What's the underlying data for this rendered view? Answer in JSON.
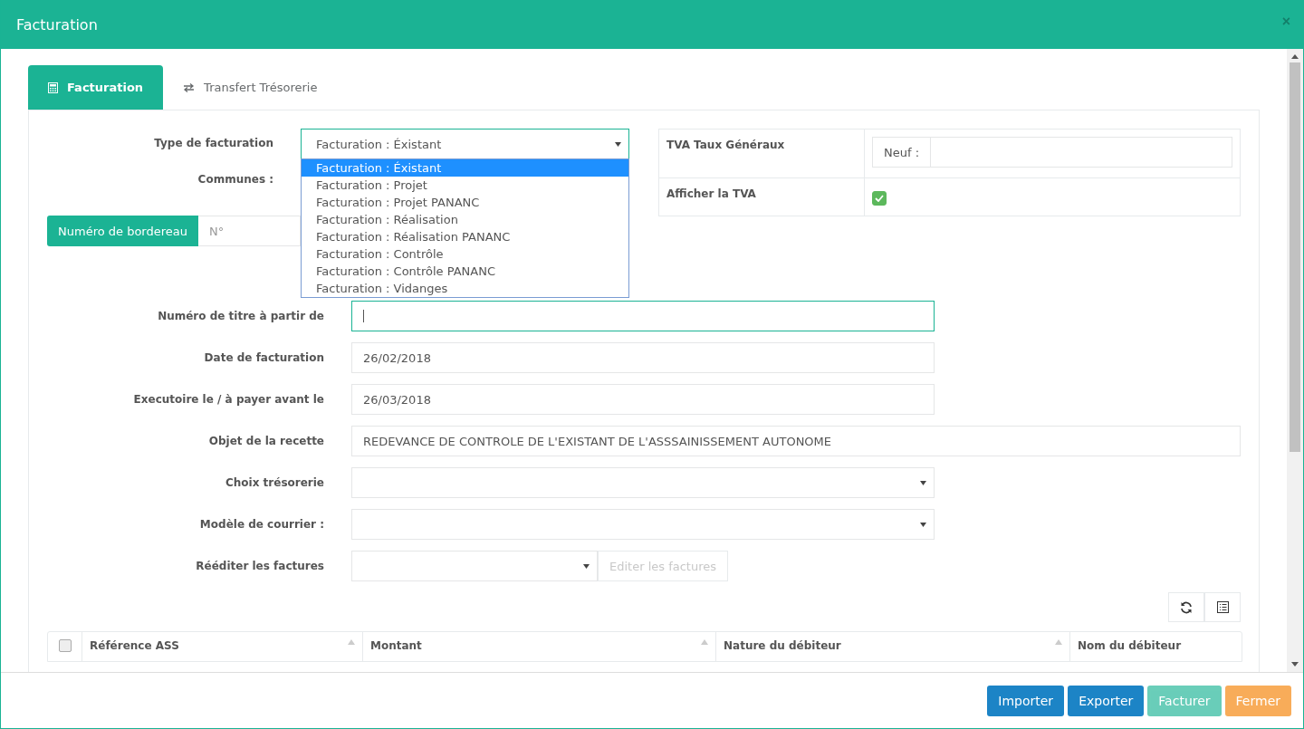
{
  "window": {
    "title": "Facturation",
    "close": "×"
  },
  "tabs": [
    {
      "label": "Facturation",
      "selected": true
    },
    {
      "label": "Transfert Trésorerie",
      "selected": false
    }
  ],
  "type_facturation": {
    "label": "Type de facturation",
    "value": "Facturation : Éxistant",
    "expanded": true,
    "options": [
      {
        "label": "Facturation : Éxistant",
        "selected": true
      },
      {
        "label": "Facturation : Projet",
        "selected": false
      },
      {
        "label": "Facturation : Projet PANANC",
        "selected": false
      },
      {
        "label": "Facturation : Réalisation",
        "selected": false
      },
      {
        "label": "Facturation : Réalisation PANANC",
        "selected": false
      },
      {
        "label": "Facturation : Contrôle",
        "selected": false
      },
      {
        "label": "Facturation : Contrôle PANANC",
        "selected": false
      },
      {
        "label": "Facturation : Vidanges",
        "selected": false
      }
    ]
  },
  "communes": {
    "label": "Communes :"
  },
  "tva": {
    "taux_label": "TVA Taux Généraux",
    "neuf_label": "Neuf :",
    "afficher_label": "Afficher la TVA",
    "afficher_checked": true
  },
  "bordereau": {
    "label": "Numéro de bordereau",
    "placeholder": "N°"
  },
  "fields": [
    {
      "kind": "text",
      "label": "Numéro de titre à partir de",
      "focused": true
    },
    {
      "kind": "text",
      "label": "Date de facturation",
      "value": "26/02/2018",
      "focused": false
    },
    {
      "kind": "text",
      "label": "Executoire le / à payer avant le",
      "value": "26/03/2018",
      "focused": false
    },
    {
      "kind": "wide",
      "label": "Objet de la recette",
      "value": "REDEVANCE DE CONTROLE DE L'EXISTANT DE L'ASSSAINISSEMENT AUTONOME",
      "focused": false
    },
    {
      "kind": "select",
      "label": "Choix trésorerie",
      "focused": false
    },
    {
      "kind": "select",
      "label": "Modèle de courrier :",
      "focused": false
    },
    {
      "kind": "select-button",
      "label": "Rééditer les factures",
      "focused": false,
      "button": "Editer les factures",
      "button_disabled": true
    }
  ],
  "table": {
    "select_all_checked": false,
    "columns": [
      "Référence ASS",
      "Montant",
      "Nature du débiteur",
      "Nom du débiteur"
    ]
  },
  "footer_buttons": [
    {
      "label": "Importer",
      "kind": "primary",
      "disabled": false
    },
    {
      "label": "Exporter",
      "kind": "primary",
      "disabled": false
    },
    {
      "label": "Facturer",
      "kind": "success",
      "disabled": true
    },
    {
      "label": "Fermer",
      "kind": "warning",
      "disabled": false
    }
  ]
}
